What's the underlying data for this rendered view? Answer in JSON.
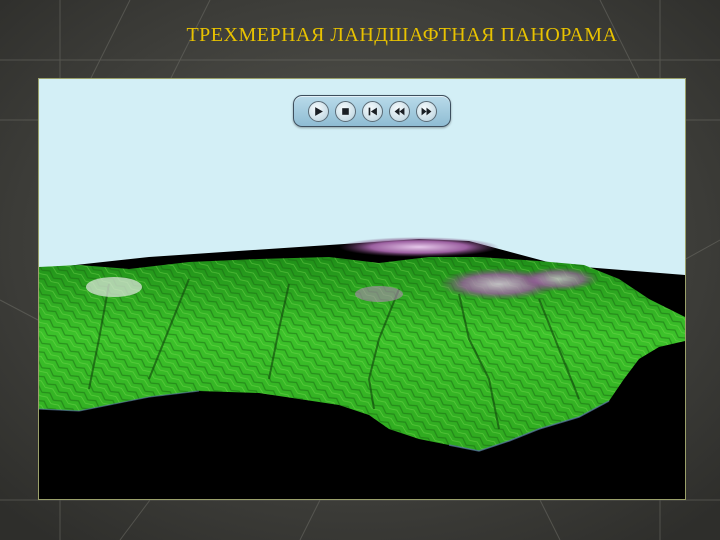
{
  "slide": {
    "title": "ТРЕХМЕРНАЯ  ЛАНДШАФТНАЯ  ПАНОРАМА"
  },
  "colors": {
    "background": "#4a4a46",
    "title_text": "#e8c200",
    "sky": "#d3eff6",
    "water": "#000000",
    "terrain_green": "#3fbf1f",
    "snow_purple": "#a070a0"
  },
  "media_controls": {
    "buttons": [
      {
        "name": "play-icon"
      },
      {
        "name": "stop-icon"
      },
      {
        "name": "skip-to-start-icon"
      },
      {
        "name": "rewind-icon"
      },
      {
        "name": "fast-forward-icon"
      }
    ]
  }
}
